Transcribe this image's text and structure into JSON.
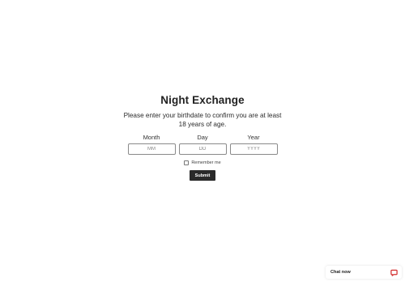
{
  "gate": {
    "title": "Night Exchange",
    "description": "Please enter your birthdate to confirm you are at least 18 years of age.",
    "fields": [
      {
        "label": "Month",
        "placeholder": "MM",
        "value": ""
      },
      {
        "label": "Day",
        "placeholder": "DD",
        "value": ""
      },
      {
        "label": "Year",
        "placeholder": "YYYY",
        "value": ""
      }
    ],
    "remember_label": "Remember me",
    "remember_checked": false,
    "submit_label": "Submit"
  },
  "chat": {
    "label": "Chat now",
    "icon": "chat-bubble-icon",
    "accent_color": "#d32f2f"
  },
  "colors": {
    "background": "#ffffff",
    "button": "#2a2a2a",
    "button_text": "#ffffff"
  }
}
